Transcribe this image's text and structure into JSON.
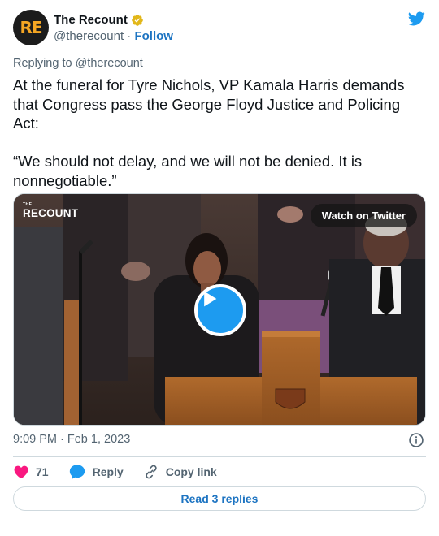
{
  "account": {
    "avatar_text": "RE",
    "name": "The Recount",
    "handle": "@therecount",
    "separator": "·",
    "follow_label": "Follow"
  },
  "tweet": {
    "replying_to": "Replying to @therecount",
    "text": "At the funeral for Tyre Nichols, VP Kamala Harris demands that Congress pass the George Floyd Justice and Policing Act:\n\n“We should not delay, and we will not be denied. It is nonnegotiable.”",
    "timestamp": "9:09 PM · Feb 1, 2023"
  },
  "media": {
    "logo_small": "THE",
    "logo_text": "RECOUNT",
    "watch_label": "Watch on Twitter"
  },
  "actions": {
    "like_count": "71",
    "reply_label": "Reply",
    "copy_label": "Copy link"
  },
  "read_replies_label": "Read 3 replies",
  "colors": {
    "accent": "#1d9bf0",
    "link": "#1d74c2",
    "like": "#f91880",
    "verified": "#e2b719"
  },
  "icons": {
    "bird": "twitter-bird-icon",
    "verified": "verified-badge-icon",
    "like": "heart-icon",
    "reply": "speech-bubble-icon",
    "copy": "link-icon",
    "info": "info-icon",
    "play": "play-icon"
  }
}
